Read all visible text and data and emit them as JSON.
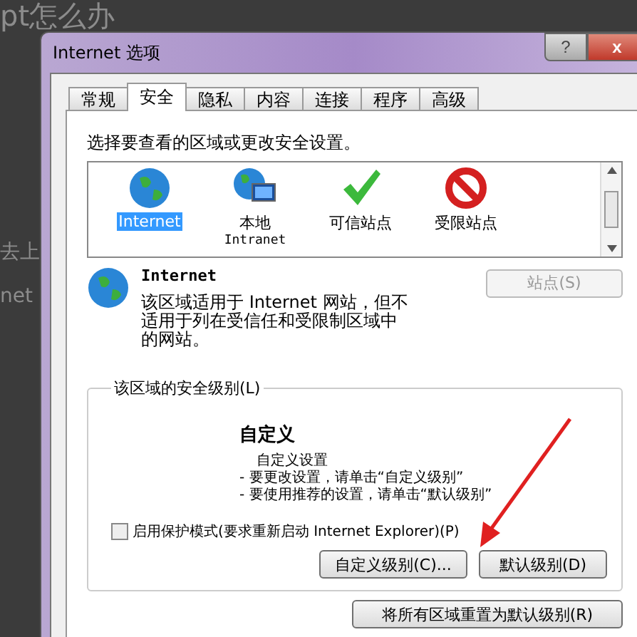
{
  "background_text": [
    "pt怎么办",
    "去上",
    "net"
  ],
  "window": {
    "title": "Internet 选项",
    "help_button": "?",
    "close_button": "x"
  },
  "tabs": [
    {
      "label": "常规",
      "selected": false
    },
    {
      "label": "安全",
      "selected": true
    },
    {
      "label": "隐私",
      "selected": false
    },
    {
      "label": "内容",
      "selected": false
    },
    {
      "label": "连接",
      "selected": false
    },
    {
      "label": "程序",
      "selected": false
    },
    {
      "label": "高级",
      "selected": false
    }
  ],
  "prompt": "选择要查看的区域或更改安全设置。",
  "zones": [
    {
      "label": "Internet",
      "kind": "globe",
      "selected": true
    },
    {
      "label": "本地",
      "sublabel": "Intranet",
      "kind": "intranet",
      "selected": false
    },
    {
      "label": "可信站点",
      "kind": "trusted",
      "selected": false
    },
    {
      "label": "受限站点",
      "kind": "restricted",
      "selected": false
    }
  ],
  "zone_info": {
    "title": "Internet",
    "description": "该区域适用于 Internet 网站，但不适用于列在受信任和受限制区域中的网站。",
    "sites_button": {
      "label": "站点(S)",
      "disabled": true
    }
  },
  "security_level": {
    "legend": "该区域的安全级别(L)",
    "level_name": "自定义",
    "lines": [
      "自定义设置",
      "- 要更改设置，请单击“自定义级别”",
      "- 要使用推荐的设置，请单击“默认级别”"
    ],
    "protected_mode": {
      "label": "启用保护模式(要求重新启动 Internet Explorer)(P)",
      "checked": false
    },
    "buttons": [
      "自定义级别(C)...",
      "默认级别(D)"
    ]
  },
  "reset_button": "将所有区域重置为默认级别(R)"
}
